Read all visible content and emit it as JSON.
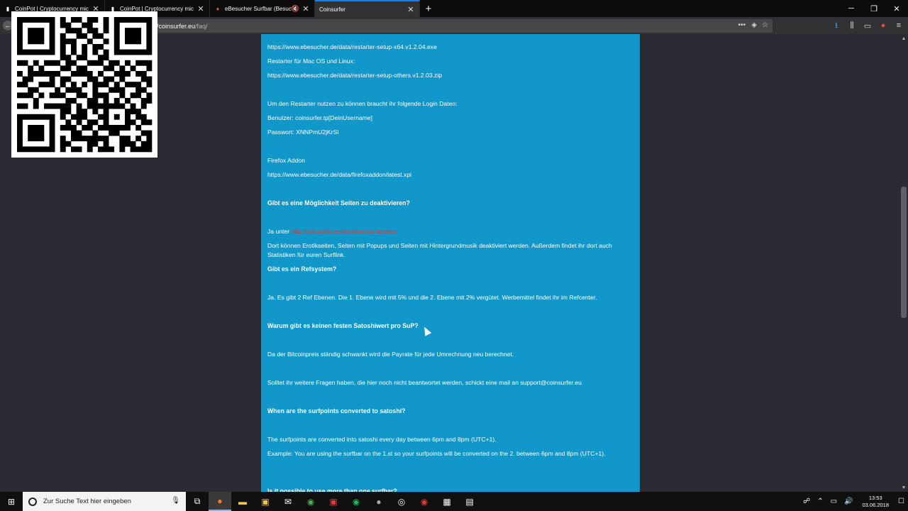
{
  "tabs": [
    {
      "title": "CoinPot | Cryptocurrency mic",
      "active": false,
      "icon": "coinpot-icon"
    },
    {
      "title": "CoinPot | Cryptocurrency mic",
      "active": false,
      "icon": "coinpot-icon"
    },
    {
      "title": "eBesucher Surfbar (Besuch",
      "active": false,
      "icon": "ebesucher-icon",
      "muted": true
    },
    {
      "title": "Coinsurfer",
      "active": true,
      "icon": ""
    }
  ],
  "address": {
    "host": "://coinsurfer.eu",
    "path": "/faq/"
  },
  "content": {
    "lines": [
      {
        "text": "https://www.ebesucher.de/data/restarter-setup-x64.v1.2.04.exe",
        "bold": false
      },
      {
        "text": "Restarter für Mac OS und Linux:",
        "bold": false
      },
      {
        "text": "https://www.ebesucher.de/data/restarter-setup-others.v1.2.03.zip",
        "bold": false
      },
      {
        "text": "Um den Restarter nutzen zu können braucht ihr folgende Login Daten:",
        "bold": false
      },
      {
        "text": "Benutzer: coinsurfer.tp[DeinUsername]",
        "bold": false
      },
      {
        "text": "Passwort: XNNPmU2jKrSl",
        "bold": false
      },
      {
        "text": "Firefox Addon",
        "bold": false
      },
      {
        "text": "https://www.ebesucher.de/data/firefoxaddon/latest.xpi",
        "bold": false
      },
      {
        "text": "Gibt es eine Möglichkeit Seiten zu deaktivieren?",
        "bold": true
      },
      {
        "text": "Ja unter",
        "bold": false,
        "link": "http://coinsurfer.eu/member/surfoptions"
      },
      {
        "text": "Dort können Erotikseiten, Seiten mit Popups und Seiten mit Hintergrundmusik deaktiviert werden. Außerdem findet ihr dort auch Statistiken für euren Surflink.",
        "bold": false
      },
      {
        "text": "Gibt es ein Refsystem?",
        "bold": true
      },
      {
        "text": "Ja. Es gibt 2 Ref Ebenen. Die 1. Ebene wird mit 5% und die 2. Ebene mit 2% vergütet. Werbemittel findet ihr im Refcenter.",
        "bold": false
      },
      {
        "text": "Warum gibt es keinen festen Satoshiwert pro SuP?",
        "bold": true
      },
      {
        "text": "Da der Bitcoinpreis ständig schwankt wird die Payrate für jede Umrechnung neu berechnet.",
        "bold": false
      },
      {
        "text": "Solltet ihr weitere Fragen haben, die hier noch nicht beantwortet werden, schickt eine mail an support@coinsurfer.eu",
        "bold": false
      },
      {
        "text": "When are the surfpoints converted to satoshi?",
        "bold": true
      },
      {
        "text": "The surfpoints are converted into satoshi every day between 6pm and 8pm (UTC+1).",
        "bold": false
      },
      {
        "text": "Example: You are using the surfbar on the 1.st so your surfpoints will be converted on the 2. between 6pm and 8pm (UTC+1).",
        "bold": false
      },
      {
        "text": "Is it possible to use more than one surfbar?",
        "bold": true
      }
    ]
  },
  "taskbar": {
    "search_placeholder": "Zur Suche Text hier eingeben",
    "time": "13:53",
    "date": "03.06.2018"
  },
  "qr_modules": [
    "1111111010110110101111111",
    "1000001011001100101000001",
    "1011101001110110101011101",
    "1011101010011011001011101",
    "1011101011100100101011101",
    "1000001010101011001000001",
    "1111111010101010101111111",
    "0000000011011001100000000",
    "1101011101100111011010111",
    "0010100011011000110101001",
    "1011111100111101001110110",
    "0110001011000110110100011",
    "1100111010101011101011101",
    "0011000101110010011100110",
    "1110101110011011100101101",
    "0001000001100110101010011",
    "1101011111010111111101010",
    "0000000011011010100011100",
    "1111111010111001101010110",
    "1000001001010110100011011",
    "1011101011101101111110100",
    "1011101000110010011000011",
    "1011101010111111100110101",
    "1000001011000110100111011",
    "1111111010110101110101111"
  ]
}
